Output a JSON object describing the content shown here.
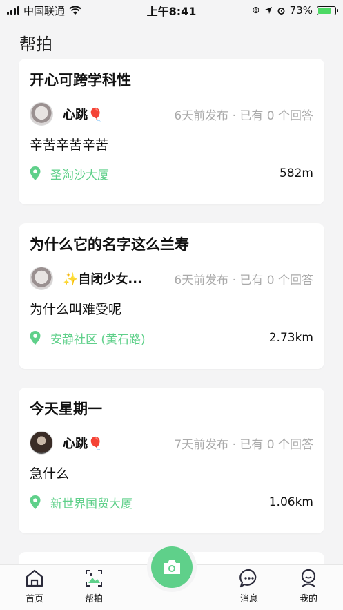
{
  "status_bar": {
    "carrier": "中国联通",
    "time": "上午8:41",
    "battery": "73%",
    "battery_level": 0.73
  },
  "page": {
    "title": "帮拍"
  },
  "posts": [
    {
      "title": "开心可跨学科性",
      "user": "心跳🎈",
      "meta": "6天前发布 · 已有 0 个回答",
      "body": "辛苦辛苦辛苦",
      "location": "圣淘沙大厦",
      "distance": "582m"
    },
    {
      "title": "为什么它的名字这么兰寿",
      "user": "✨自闭少女...",
      "meta": "6天前发布 · 已有 0 个回答",
      "body": "为什么叫难受呢",
      "location": "安静社区 (黄石路)",
      "distance": "2.73km"
    },
    {
      "title": "今天星期一",
      "user": "心跳🎈",
      "meta": "7天前发布 · 已有 0 个回答",
      "body": "急什么",
      "location": "新世界国贸大厦",
      "distance": "1.06km"
    }
  ],
  "tabs": {
    "home": "首页",
    "help_shoot": "帮拍",
    "messages": "消息",
    "mine": "我的"
  },
  "colors": {
    "accent": "#5fd08a",
    "background": "#f4f4f5"
  },
  "icons": [
    "signal-icon",
    "wifi-icon",
    "location-arrow-icon",
    "alarm-icon",
    "battery-icon",
    "pin-icon",
    "home-icon",
    "photo-icon",
    "camera-icon",
    "chat-icon",
    "profile-icon"
  ]
}
